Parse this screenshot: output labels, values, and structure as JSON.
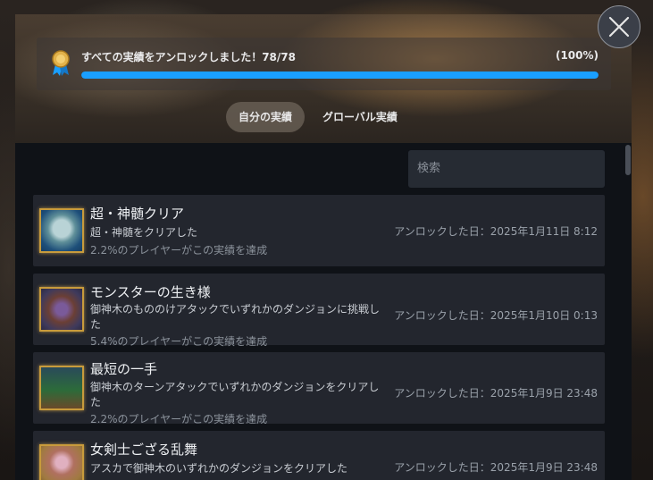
{
  "progress": {
    "title": "すべての実績をアンロックしました！78/78",
    "percent": "(100%)",
    "fill_fraction": 1.0
  },
  "tabs": [
    {
      "label": "自分の実績",
      "active": true
    },
    {
      "label": "グローバル実績",
      "active": false
    }
  ],
  "search": {
    "placeholder": "検索"
  },
  "achievements": [
    {
      "title": "超・神髄クリア",
      "description": "超・神髄をクリアした",
      "percent_text": "2.2%のプレイヤーがこの実績を達成",
      "unlocked": "アンロックした日：2025年1月11日 8:12",
      "icon": "ghost-icon"
    },
    {
      "title": "モンスターの生き様",
      "description": "御神木のもののけアタックでいずれかのダンジョンに挑戦した",
      "percent_text": "5.4%のプレイヤーがこの実績を達成",
      "unlocked": "アンロックした日：2025年1月10日 0:13",
      "icon": "monster-icon"
    },
    {
      "title": "最短の一手",
      "description": "御神木のターンアタックでいずれかのダンジョンをクリアした",
      "percent_text": "2.2%のプレイヤーがこの実績を達成",
      "unlocked": "アンロックした日：2025年1月9日 23:48",
      "icon": "turn-icon"
    },
    {
      "title": "女剣士ござる乱舞",
      "description": "アスカで御神木のいずれかのダンジョンをクリアした",
      "percent_text": "",
      "unlocked": "アンロックした日：2025年1月9日 23:48",
      "icon": "swordswoman-icon"
    }
  ],
  "colors": {
    "accent": "#1a9fff",
    "row_bg": "#23262e",
    "dialog_bg": "#0f1217",
    "medal_gold": "#d9a63a"
  }
}
